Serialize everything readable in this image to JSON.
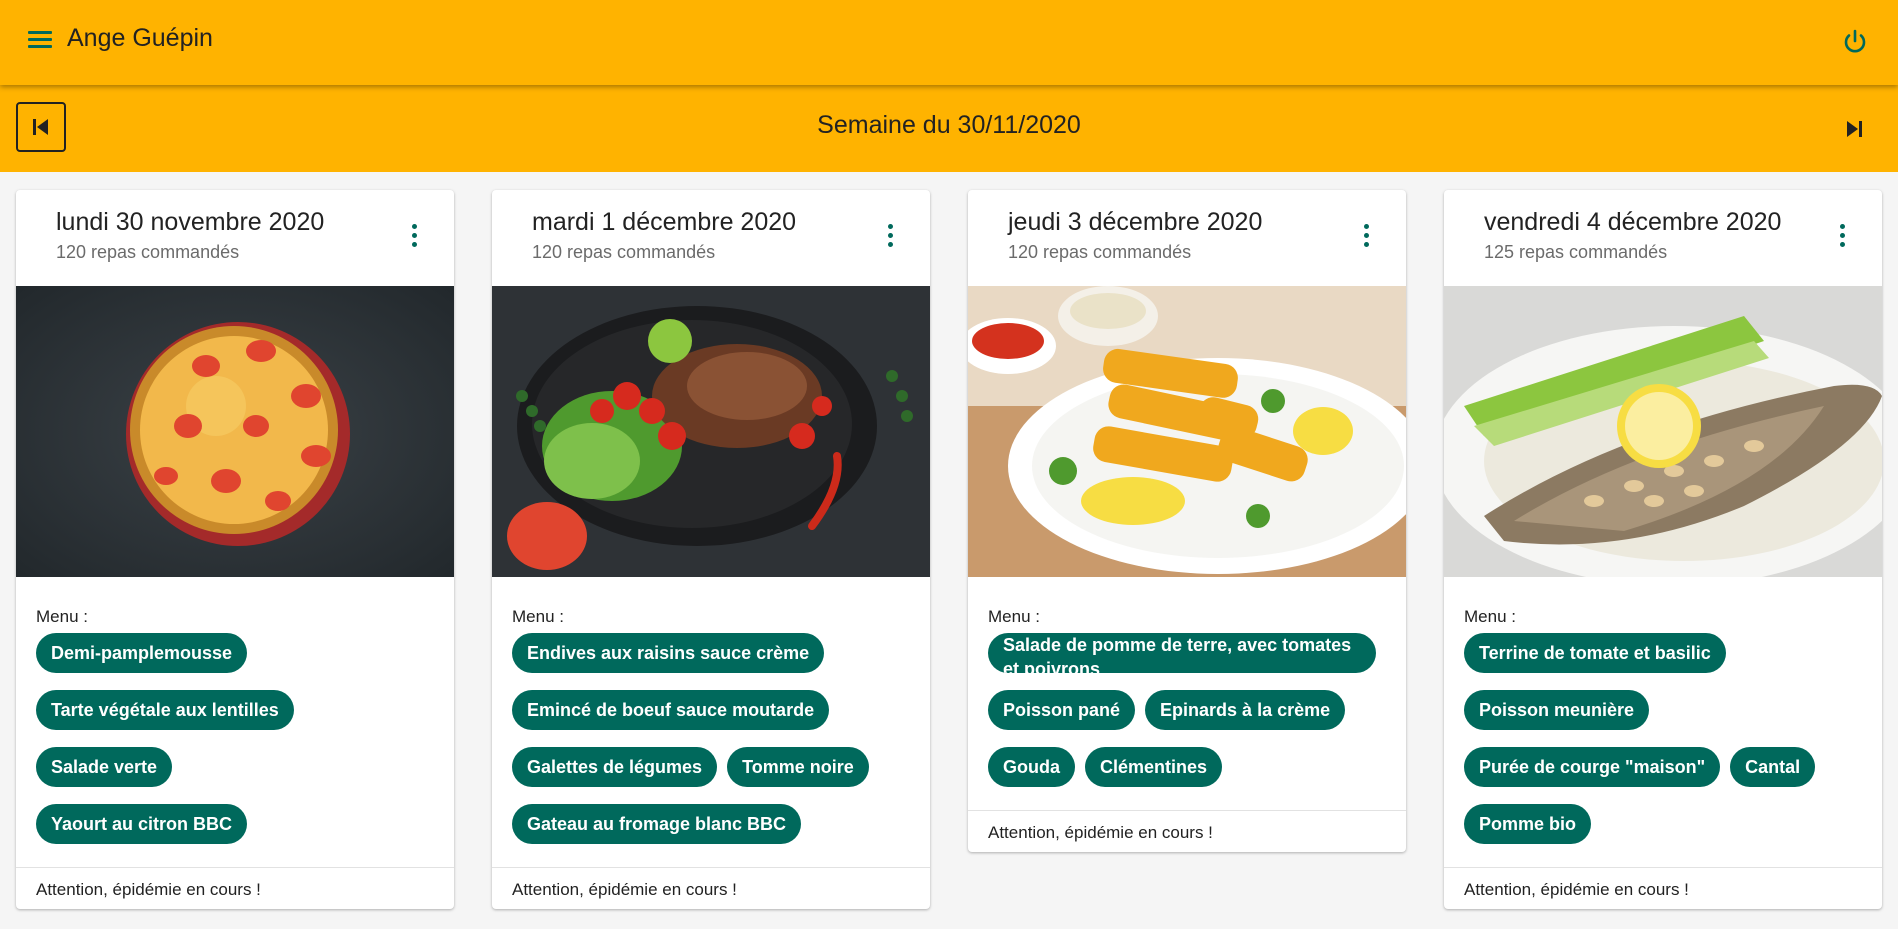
{
  "app": {
    "title": "Ange Guépin",
    "menu_icon": "hamburger-menu-icon",
    "power_icon": "power-icon",
    "accent_color": "#ffb300",
    "chip_color": "#00695c"
  },
  "week": {
    "title": "Semaine du 30/11/2020",
    "prev_icon": "skip-previous-icon",
    "next_icon": "skip-next-icon"
  },
  "menu_label": "Menu :",
  "days": [
    {
      "title": "lundi 30 novembre 2020",
      "subtitle": "120 repas commandés",
      "image": "quiche-tomato-photo",
      "rows": [
        [
          "Demi-pamplemousse"
        ],
        [
          "Tarte végétale aux lentilles",
          "Salade verte"
        ],
        [
          "Yaourt au citron BBC"
        ]
      ],
      "footer": "Attention, épidémie en cours !"
    },
    {
      "title": "mardi 1 décembre 2020",
      "subtitle": "120 repas commandés",
      "image": "grilled-steak-salad-photo",
      "rows": [
        [
          "Endives aux raisins sauce crème"
        ],
        [
          "Emincé de boeuf sauce moutarde"
        ],
        [
          "Galettes de légumes",
          "Tomme noire"
        ],
        [
          "Gateau au fromage blanc BBC"
        ]
      ],
      "footer": "Attention, épidémie en cours !"
    },
    {
      "title": "jeudi 3 décembre 2020",
      "subtitle": "120 repas commandés",
      "image": "fish-sticks-photo",
      "rows": [
        [
          "Salade de pomme de terre, avec tomates et poivrons"
        ],
        [
          "Poisson pané",
          "Epinards à la crème"
        ],
        [
          "Gouda",
          "Clémentines"
        ]
      ],
      "footer": "Attention, épidémie en cours !"
    },
    {
      "title": "vendredi 4 décembre 2020",
      "subtitle": "125 repas commandés",
      "image": "fish-meuniere-photo",
      "rows": [
        [
          "Terrine de tomate et basilic"
        ],
        [
          "Poisson meunière"
        ],
        [
          "Purée de courge \"maison\"",
          "Cantal"
        ],
        [
          "Pomme bio"
        ]
      ],
      "footer": "Attention, épidémie en cours !"
    }
  ]
}
